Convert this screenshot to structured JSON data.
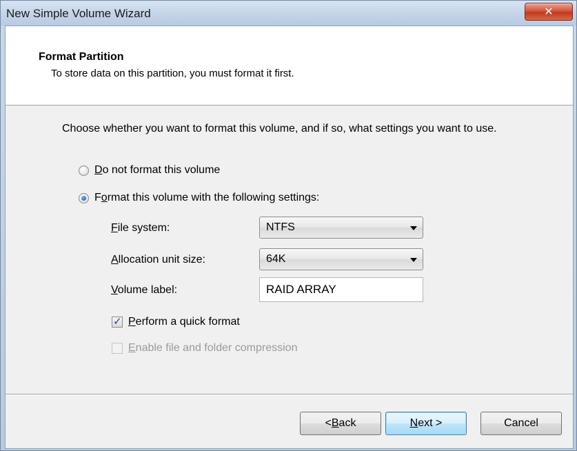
{
  "window": {
    "title": "New Simple Volume Wizard",
    "close_glyph": "✕"
  },
  "header": {
    "title": "Format Partition",
    "subtitle": "To store data on this partition, you must format it first."
  },
  "instruction": "Choose whether you want to format this volume, and if so, what settings you want to use.",
  "options": {
    "no_format": {
      "label_accel": "D",
      "label_rest": "o not format this volume",
      "selected": false
    },
    "format": {
      "label_pre": "F",
      "label_accel": "o",
      "label_rest": "rmat this volume with the following settings:",
      "selected": true
    }
  },
  "settings": {
    "file_system": {
      "label_accel": "F",
      "label_rest": "ile system:",
      "value": "NTFS"
    },
    "allocation": {
      "label_accel": "A",
      "label_rest": "llocation unit size:",
      "value": "64K"
    },
    "volume_label": {
      "label_accel": "V",
      "label_rest": "olume label:",
      "value": "RAID ARRAY"
    }
  },
  "checks": {
    "quick_format": {
      "label_accel": "P",
      "label_rest": "erform a quick format",
      "checked": true,
      "enabled": true
    },
    "compression": {
      "label_accel": "E",
      "label_rest": "nable file and folder compression",
      "checked": false,
      "enabled": false
    }
  },
  "buttons": {
    "back": {
      "prefix": "< ",
      "accel": "B",
      "rest": "ack"
    },
    "next": {
      "accel": "N",
      "rest": "ext >"
    },
    "cancel": {
      "label": "Cancel"
    }
  }
}
